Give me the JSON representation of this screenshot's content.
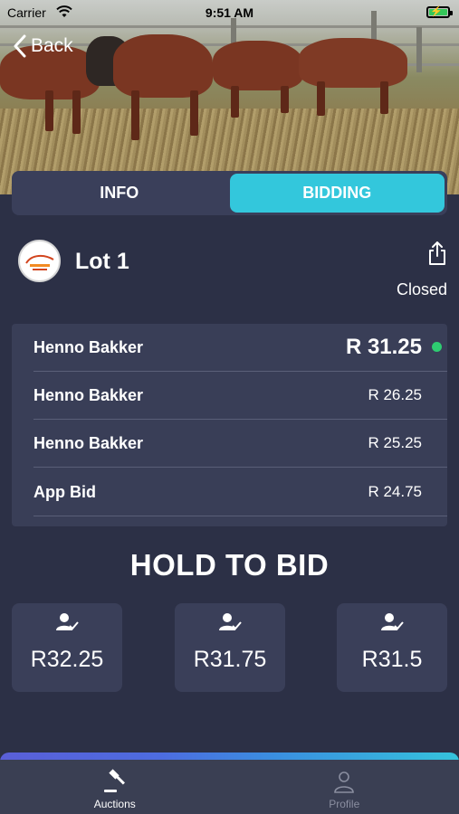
{
  "status_bar": {
    "carrier": "Carrier",
    "time": "9:51 AM"
  },
  "header": {
    "back_label": "Back"
  },
  "tabs": [
    {
      "label": "INFO",
      "active": false
    },
    {
      "label": "BIDDING",
      "active": true
    }
  ],
  "lot": {
    "title": "Lot 1",
    "status": "Closed"
  },
  "bids": [
    {
      "bidder": "Henno Bakker",
      "amount": "R 31.25",
      "leading": true
    },
    {
      "bidder": "Henno Bakker",
      "amount": "R 26.25"
    },
    {
      "bidder": "Henno Bakker",
      "amount": "R 25.25"
    },
    {
      "bidder": "App Bid",
      "amount": "R 24.75"
    }
  ],
  "hold_to_bid": "HOLD TO BID",
  "bid_options": [
    "R32.25",
    "R31.75",
    "R31.5"
  ],
  "tab_bar": [
    {
      "label": "Auctions",
      "icon": "gavel-icon",
      "active": true
    },
    {
      "label": "Profile",
      "icon": "person-icon",
      "active": false
    }
  ],
  "colors": {
    "accent": "#33c7dc",
    "background": "#2c3046",
    "leading_dot": "#2ecc71"
  }
}
